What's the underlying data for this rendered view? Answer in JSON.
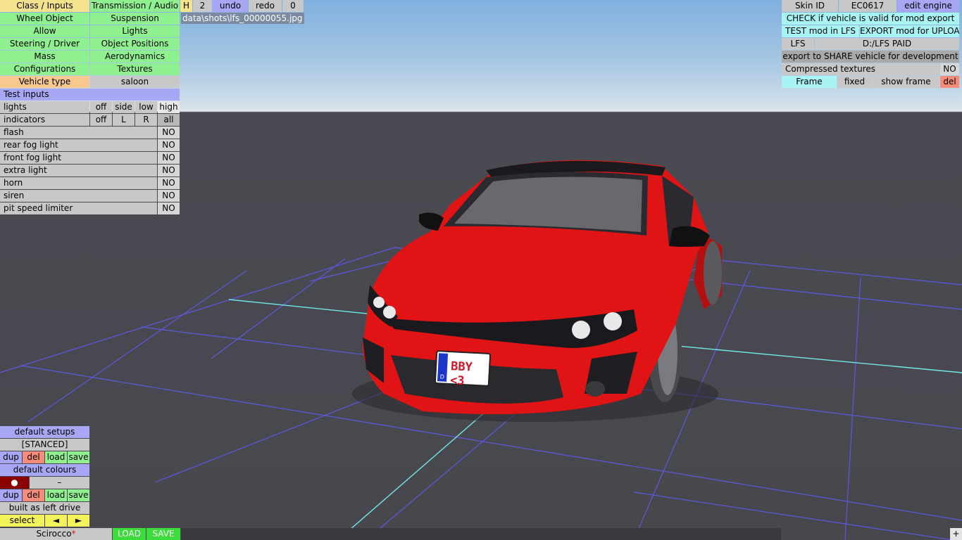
{
  "topbar": {
    "class_inputs": "Class / Inputs",
    "transmission_audio": "Transmission / Audio",
    "h": "H",
    "two": "2",
    "undo": "undo",
    "redo": "redo",
    "zero": "0"
  },
  "screenshot_path": "data\\shots\\lfs_00000055.jpg",
  "left_menu": {
    "wheel_object": "Wheel Object",
    "suspension": "Suspension",
    "allow": "Allow",
    "lights": "Lights",
    "steering_driver": "Steering / Driver",
    "object_positions": "Object Positions",
    "mass": "Mass",
    "aerodynamics": "Aerodynamics",
    "configurations": "Configurations",
    "textures": "Textures",
    "vehicle_type_label": "Vehicle type",
    "vehicle_type_value": "saloon"
  },
  "test_inputs": {
    "header": "Test inputs",
    "lights": {
      "label": "lights",
      "options": [
        "off",
        "side",
        "low",
        "high"
      ]
    },
    "indicators": {
      "label": "indicators",
      "options": [
        "off",
        "L",
        "R",
        "all"
      ]
    },
    "rows": [
      {
        "label": "flash",
        "value": "NO"
      },
      {
        "label": "rear fog light",
        "value": "NO"
      },
      {
        "label": "front fog light",
        "value": "NO"
      },
      {
        "label": "extra light",
        "value": "NO"
      },
      {
        "label": "horn",
        "value": "NO"
      },
      {
        "label": "siren",
        "value": "NO"
      },
      {
        "label": "pit speed limiter",
        "value": "NO"
      }
    ]
  },
  "right_panel": {
    "skin_id": "Skin ID",
    "skin_value": "EC0617",
    "edit_engine": "edit engine",
    "check_valid": "CHECK if vehicle is valid for mod export",
    "test_mod": "TEST mod in LFS",
    "export_upload": "EXPORT mod for UPLOAD",
    "lfs": "LFS",
    "lfs_path": "D:/LFS PAID",
    "export_share": "export to SHARE vehicle for development",
    "compressed_textures": "Compressed textures",
    "compressed_value": "NO",
    "frame": "Frame",
    "fixed": "fixed",
    "show_frame": "show frame",
    "del": "del"
  },
  "bottom_left": {
    "default_setups": "default setups",
    "setup_name": "[STANCED]",
    "dup": "dup",
    "del": "del",
    "load": "load",
    "save": "save",
    "default_colours": "default colours",
    "colour_dot": "●",
    "colour_dash": "–",
    "left_drive": "built as left drive",
    "select": "select",
    "prev_arrow": "◄",
    "next_arrow": "►"
  },
  "statusbar": {
    "vehicle_name": "Scirocco",
    "modified_mark": "*",
    "load": "LOAD",
    "save": "SAVE",
    "plus": "+"
  },
  "scene": {
    "license_plate": "BBY <3",
    "plate_country": "D",
    "car_color": "#e01414"
  }
}
